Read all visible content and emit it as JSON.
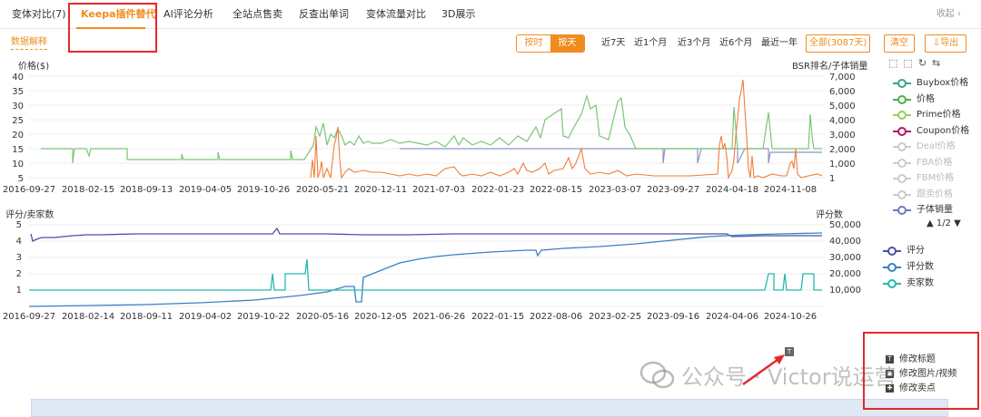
{
  "tabs": [
    {
      "label": "变体对比(7)"
    },
    {
      "label": "Keepa插件替代"
    },
    {
      "label": "AI评论分析"
    },
    {
      "label": "全站点售卖"
    },
    {
      "label": "反查出单词"
    },
    {
      "label": "变体流量对比"
    },
    {
      "label": "3D展示"
    }
  ],
  "collapse_label": "收起",
  "toolbar": {
    "data_explain": "数据解释",
    "time_mode": [
      "按时",
      "按天"
    ],
    "ranges": [
      "近7天",
      "近1个月",
      "近3个月",
      "近6个月",
      "最近一年",
      "全部(3087天)"
    ],
    "clear_label": "清空",
    "export_label": "导出"
  },
  "chart1": {
    "left_axis_title": "价格($)",
    "right_axis_title": "BSR排名/子体销量",
    "left_ticks": [
      "40",
      "35",
      "30",
      "25",
      "20",
      "15",
      "10",
      "5"
    ],
    "right_ticks": [
      "7,000",
      "6,000",
      "5,000",
      "4,000",
      "3,000",
      "2,000",
      "1,000",
      "1"
    ],
    "x_ticks": [
      "2016-09-27",
      "2018-02-15",
      "2018-09-13",
      "2019-04-05",
      "2019-10-26",
      "2020-05-21",
      "2020-12-11",
      "2021-07-03",
      "2022-01-23",
      "2022-08-15",
      "2023-03-07",
      "2023-09-27",
      "2024-04-18",
      "2024-11-08"
    ]
  },
  "chart2": {
    "left_axis_title": "评分/卖家数",
    "right_axis_title": "评分数",
    "left_ticks": [
      "5",
      "4",
      "3",
      "2",
      "1"
    ],
    "right_ticks": [
      "50,000",
      "40,000",
      "30,000",
      "20,000",
      "10,000"
    ],
    "x_ticks": [
      "2016-09-27",
      "2018-02-14",
      "2018-09-11",
      "2019-04-02",
      "2019-10-22",
      "2020-05-16",
      "2020-12-05",
      "2021-06-26",
      "2022-01-15",
      "2022-08-06",
      "2023-02-25",
      "2023-09-16",
      "2024-04-06",
      "2024-10-26"
    ]
  },
  "legend1": [
    {
      "label": "Buybox价格",
      "color": "#3aa38a",
      "dim": false
    },
    {
      "label": "价格",
      "color": "#4caf50",
      "dim": false
    },
    {
      "label": "Prime价格",
      "color": "#9ccc65",
      "dim": false
    },
    {
      "label": "Coupon价格",
      "color": "#b0185a",
      "dim": false
    },
    {
      "label": "Deal价格",
      "color": "#cccccc",
      "dim": true
    },
    {
      "label": "FBA价格",
      "color": "#cccccc",
      "dim": true
    },
    {
      "label": "FBM价格",
      "color": "#cccccc",
      "dim": true
    },
    {
      "label": "跟卖价格",
      "color": "#cccccc",
      "dim": true
    },
    {
      "label": "子体销量",
      "color": "#6a7bbf",
      "dim": false
    }
  ],
  "legend_pager": "▲ 1/2 ▼",
  "legend2": [
    {
      "label": "评分",
      "color": "#4c4fa8"
    },
    {
      "label": "评分数",
      "color": "#3b7fc4"
    },
    {
      "label": "卖家数",
      "color": "#26b8b0"
    }
  ],
  "context_menu": [
    {
      "label": "修改标题",
      "icon": "T"
    },
    {
      "label": "修改图片/视频",
      "icon": "▣"
    },
    {
      "label": "修改卖点",
      "icon": "✚"
    }
  ],
  "watermark": "公众号 · Victor说运营",
  "colors": {
    "accent": "#f08c1e",
    "annotation_red": "#e5282c",
    "price_green": "#7cc576",
    "bsr_orange": "#f07d3a",
    "rating_purple": "#4c4fa8",
    "rating_count_blue": "#3b7fc4",
    "sellers_teal": "#26b8b0"
  }
}
